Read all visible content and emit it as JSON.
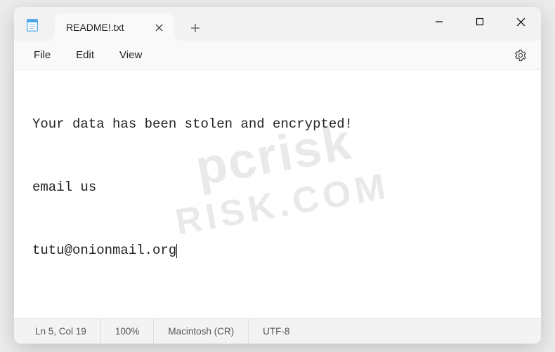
{
  "window": {
    "tab_title": "README!.txt"
  },
  "menu": {
    "file": "File",
    "edit": "Edit",
    "view": "View"
  },
  "document": {
    "line1": "Your data has been stolen and encrypted!",
    "line2": "email us",
    "line3": "tutu@onionmail.org"
  },
  "statusbar": {
    "position": "Ln 5, Col 19",
    "zoom": "100%",
    "line_ending": "Macintosh (CR)",
    "encoding": "UTF-8"
  },
  "watermark": {
    "top": "pcrisk",
    "bottom": "RISK.COM"
  }
}
